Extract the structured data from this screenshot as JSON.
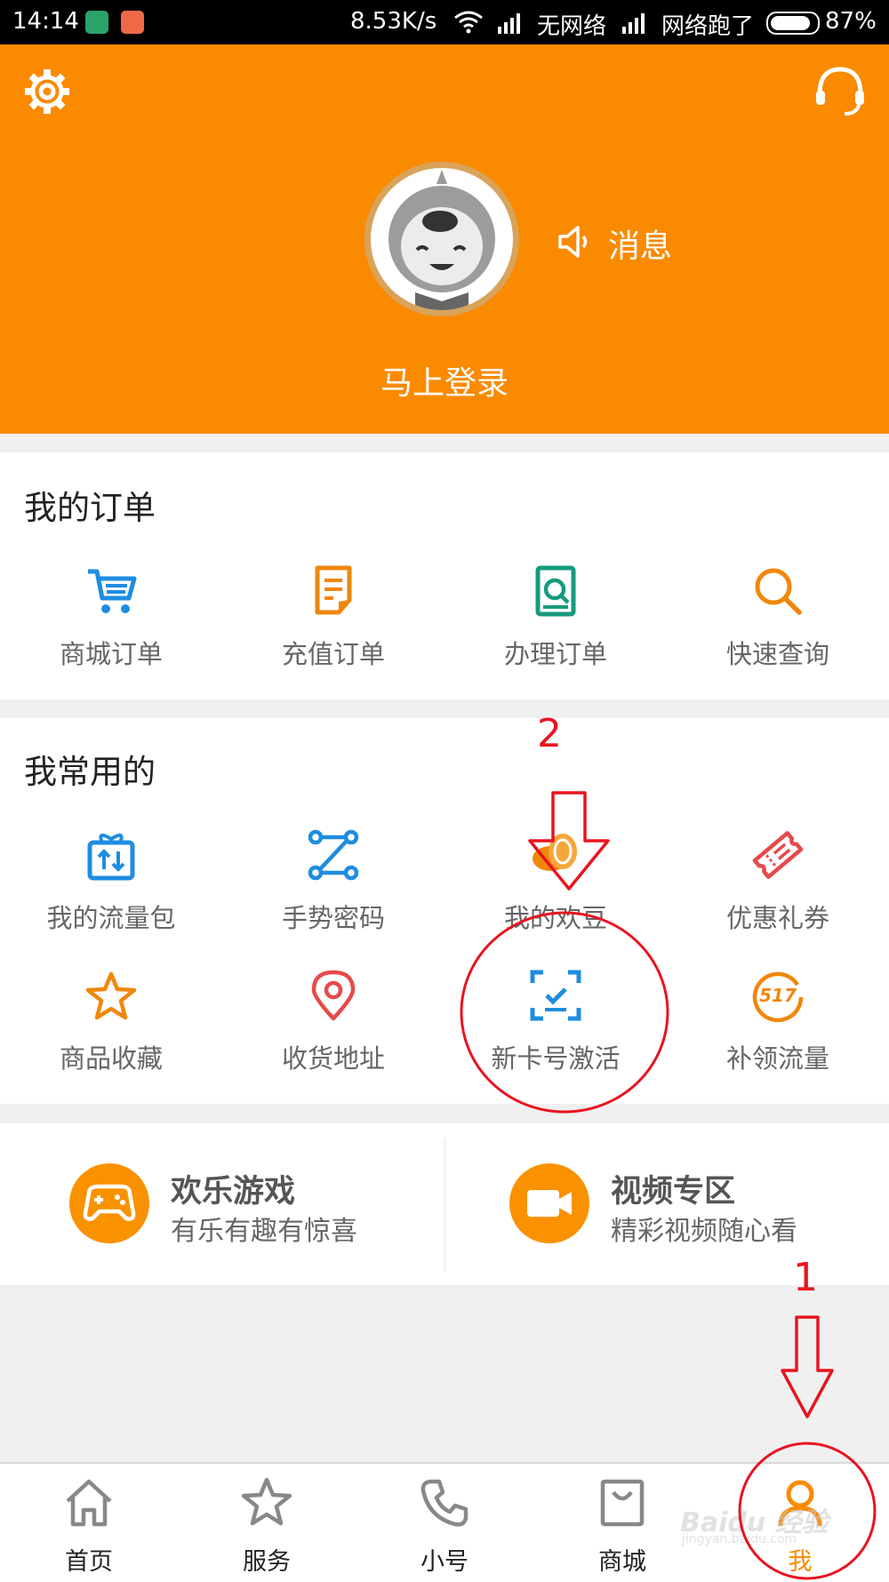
{
  "status_bar": {
    "time": "14:14",
    "network_speed": "8.53K/s",
    "sim1": "无网络",
    "sim2": "网络跑了",
    "battery": "87%"
  },
  "header": {
    "message_label": "消息",
    "login_label": "马上登录"
  },
  "orders": {
    "title": "我的订单",
    "items": [
      {
        "label": "商城订单",
        "icon": "cart-icon"
      },
      {
        "label": "充值订单",
        "icon": "document-icon"
      },
      {
        "label": "办理订单",
        "icon": "search-document-icon"
      },
      {
        "label": "快速查询",
        "icon": "search-icon"
      }
    ]
  },
  "common": {
    "title": "我常用的",
    "items": [
      {
        "label": "我的流量包",
        "icon": "data-package-icon"
      },
      {
        "label": "手势密码",
        "icon": "gesture-icon"
      },
      {
        "label": "我的欢豆",
        "icon": "coins-icon"
      },
      {
        "label": "优惠礼券",
        "icon": "ticket-icon"
      },
      {
        "label": "商品收藏",
        "icon": "star-icon"
      },
      {
        "label": "收货地址",
        "icon": "location-icon"
      },
      {
        "label": "新卡号激活",
        "icon": "scan-check-icon"
      },
      {
        "label": "补领流量",
        "icon": "517-badge-icon"
      }
    ]
  },
  "promos": [
    {
      "title": "欢乐游戏",
      "subtitle": "有乐有趣有惊喜",
      "icon": "gamepad-icon"
    },
    {
      "title": "视频专区",
      "subtitle": "精彩视频随心看",
      "icon": "video-camera-icon"
    }
  ],
  "badge_517": "517",
  "bottom_nav": [
    {
      "label": "首页",
      "icon": "home-icon"
    },
    {
      "label": "服务",
      "icon": "star-icon"
    },
    {
      "label": "小号",
      "icon": "phone-icon"
    },
    {
      "label": "商城",
      "icon": "shopping-bag-icon"
    },
    {
      "label": "我",
      "icon": "user-icon",
      "active": true
    }
  ],
  "annotations": {
    "step1": "1",
    "step2": "2"
  },
  "watermark": {
    "brand": "Baidu 经验",
    "url": "jingyan.baidu.com"
  },
  "colors": {
    "brand_orange": "#fa8a00",
    "blue_icon": "#1e8de0",
    "annotation_red": "#e8141f"
  }
}
